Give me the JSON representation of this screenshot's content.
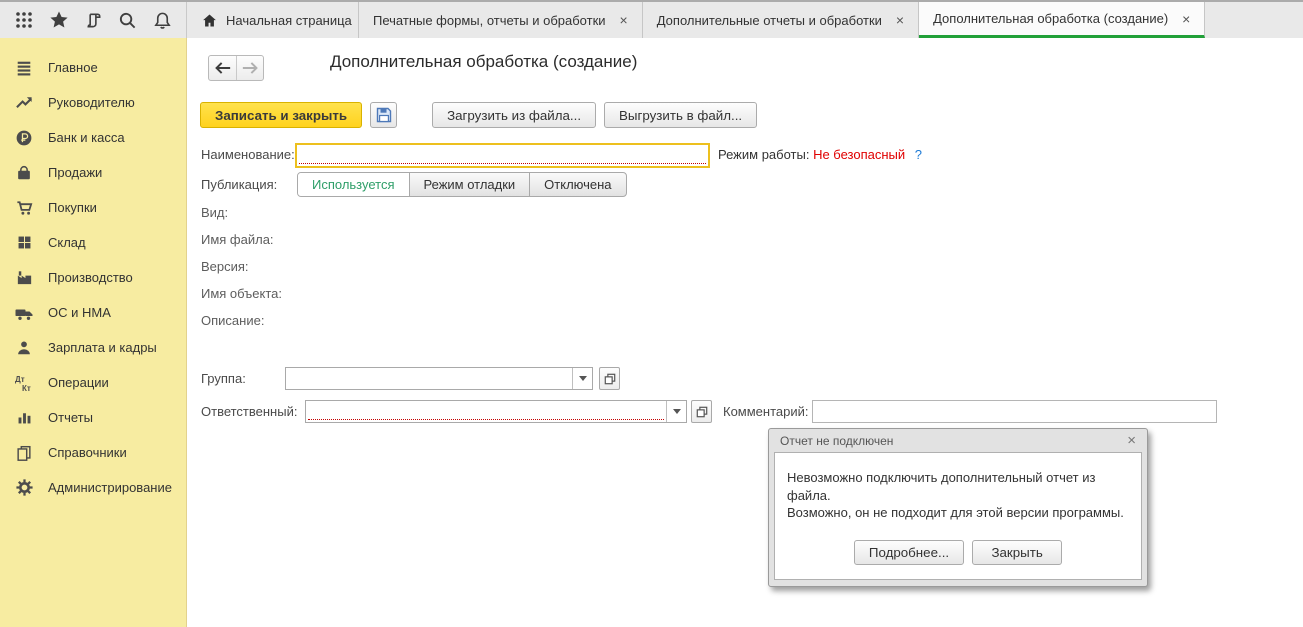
{
  "topbar": {
    "icons": [
      "menu-grid",
      "favorites-star",
      "history-scroll",
      "search",
      "notifications-bell"
    ],
    "tabs": [
      {
        "label": "Начальная страница",
        "icon": "home",
        "closable": false,
        "active": false
      },
      {
        "label": "Печатные формы, отчеты и обработки",
        "close": "×",
        "closable": true,
        "active": false
      },
      {
        "label": "Дополнительные отчеты и обработки",
        "close": "×",
        "closable": true,
        "active": false
      },
      {
        "label": "Дополнительная обработка (создание)",
        "close": "×",
        "closable": true,
        "active": true
      }
    ]
  },
  "sidebar": {
    "items": [
      {
        "label": "Главное",
        "icon": "menu"
      },
      {
        "label": "Руководителю",
        "icon": "trend-up"
      },
      {
        "label": "Банк и касса",
        "icon": "ruble-coin"
      },
      {
        "label": "Продажи",
        "icon": "bag"
      },
      {
        "label": "Покупки",
        "icon": "cart"
      },
      {
        "label": "Склад",
        "icon": "warehouse"
      },
      {
        "label": "Производство",
        "icon": "factory"
      },
      {
        "label": "ОС и НМА",
        "icon": "truck"
      },
      {
        "label": "Зарплата и кадры",
        "icon": "person"
      },
      {
        "label": "Операции",
        "icon": "dt-kt",
        "icon_text_top": "Дт",
        "icon_text_bottom": "Кт"
      },
      {
        "label": "Отчеты",
        "icon": "bar-chart"
      },
      {
        "label": "Справочники",
        "icon": "books"
      },
      {
        "label": "Администрирование",
        "icon": "gear"
      }
    ]
  },
  "main": {
    "title": "Дополнительная обработка (создание)",
    "toolbar": {
      "save_close": "Записать и закрыть",
      "save_icon": "floppy-disk",
      "load_from_file": "Загрузить из файла...",
      "unload_to_file": "Выгрузить в файл..."
    },
    "fields": {
      "name_label": "Наименование:",
      "name_value": "",
      "mode_label": "Режим работы:",
      "mode_value": "Не безопасный",
      "mode_help": "?",
      "publication_label": "Публикация:",
      "publication_options": [
        "Используется",
        "Режим отладки",
        "Отключена"
      ],
      "publication_selected": "Используется",
      "static_labels": [
        "Вид:",
        "Имя файла:",
        "Версия:",
        "Имя объекта:",
        "Описание:"
      ],
      "group_label": "Группа:",
      "group_value": "",
      "responsible_label": "Ответственный:",
      "responsible_value": "",
      "comment_label": "Комментарий:",
      "comment_value": ""
    }
  },
  "dialog": {
    "title": "Отчет не подключен",
    "close": "×",
    "message_line1": "Невозможно подключить дополнительный отчет из файла.",
    "message_line2": "Возможно, он не подходит для этой версии программы.",
    "buttons": {
      "details": "Подробнее...",
      "close": "Закрыть"
    }
  },
  "colors": {
    "accent_yellow_button": "#ffd21e",
    "sidebar_background": "#f7eca1",
    "active_tab_underline": "#21a038",
    "unsafe_mode_red": "#e00000",
    "help_blue": "#1e7bd6",
    "selected_option_green": "#2e9e68",
    "required_underline_red": "#c40000",
    "focused_field_border": "#edc01e"
  }
}
